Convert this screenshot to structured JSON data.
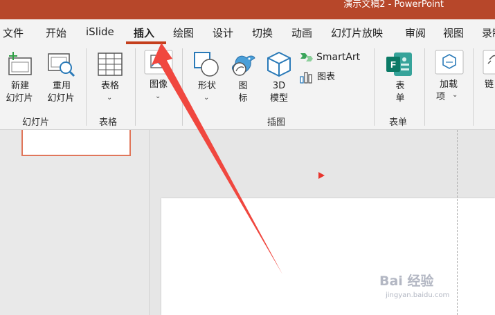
{
  "window": {
    "title": "演示文稿2  -  PowerPoint"
  },
  "tabs": [
    "文件",
    "开始",
    "iSlide",
    "插入",
    "绘图",
    "设计",
    "切换",
    "动画",
    "幻灯片放映",
    "审阅",
    "视图",
    "录制"
  ],
  "active_tab": "插入",
  "ribbon": {
    "slides": {
      "new_slide": [
        "新建",
        "幻灯片"
      ],
      "reuse_slide": [
        "重用",
        "幻灯片"
      ],
      "group": "幻灯片"
    },
    "table": {
      "table": "表格",
      "group": "表格"
    },
    "images": {
      "picture": "图像"
    },
    "illustrations": {
      "shapes": "形状",
      "icons": [
        "图",
        "标"
      ],
      "models": [
        "3D",
        "模型"
      ],
      "smartart": "SmartArt",
      "chart": "图表",
      "group": "插图"
    },
    "forms": {
      "form": [
        "表",
        "单"
      ],
      "group": "表单"
    },
    "addins": {
      "addins": [
        "加载",
        "项"
      ]
    },
    "links": {
      "link": "链"
    }
  },
  "watermark": {
    "main": "Bai 经验",
    "sub": "jingyan.baidu.com"
  },
  "colors": {
    "title_bar": "#b7472a",
    "accent": "#c43e1c",
    "arrow": "#f0473f",
    "forms_green": "#0b7a66"
  }
}
